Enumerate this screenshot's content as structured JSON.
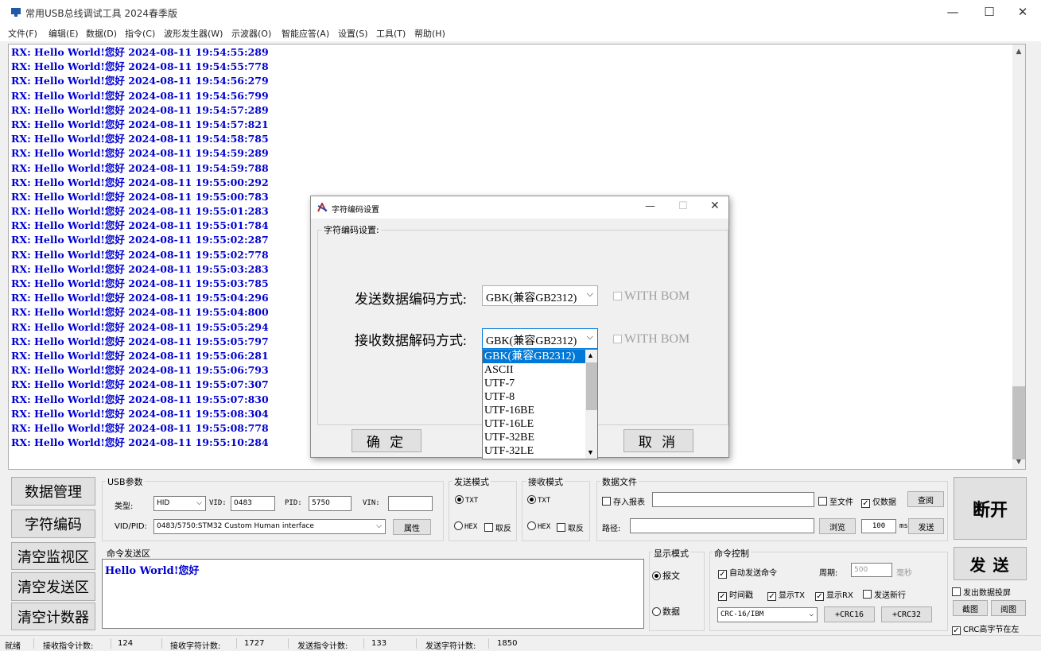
{
  "window": {
    "title": "常用USB总线调试工具 2024春季版"
  },
  "menu": [
    "文件(F)",
    "编辑(E)",
    "数据(D)",
    "指令(C)",
    "波形发生器(W)",
    "示波器(O)",
    "智能应答(A)",
    "设置(S)",
    "工具(T)",
    "帮助(H)"
  ],
  "log": {
    "lines": [
      "RX: Hello World!您好 2024-08-11 19:54:55:289",
      "RX: Hello World!您好 2024-08-11 19:54:55:778",
      "RX: Hello World!您好 2024-08-11 19:54:56:279",
      "RX: Hello World!您好 2024-08-11 19:54:56:799",
      "RX: Hello World!您好 2024-08-11 19:54:57:289",
      "RX: Hello World!您好 2024-08-11 19:54:57:821",
      "RX: Hello World!您好 2024-08-11 19:54:58:785",
      "RX: Hello World!您好 2024-08-11 19:54:59:289",
      "RX: Hello World!您好 2024-08-11 19:54:59:788",
      "RX: Hello World!您好 2024-08-11 19:55:00:292",
      "RX: Hello World!您好 2024-08-11 19:55:00:783",
      "RX: Hello World!您好 2024-08-11 19:55:01:283",
      "RX: Hello World!您好 2024-08-11 19:55:01:784",
      "RX: Hello World!您好 2024-08-11 19:55:02:287",
      "RX: Hello World!您好 2024-08-11 19:55:02:778",
      "RX: Hello World!您好 2024-08-11 19:55:03:283",
      "RX: Hello World!您好 2024-08-11 19:55:03:785",
      "RX: Hello World!您好 2024-08-11 19:55:04:296",
      "RX: Hello World!您好 2024-08-11 19:55:04:800",
      "RX: Hello World!您好 2024-08-11 19:55:05:294",
      "RX: Hello World!您好 2024-08-11 19:55:05:797",
      "RX: Hello World!您好 2024-08-11 19:55:06:281",
      "RX: Hello World!您好 2024-08-11 19:55:06:793",
      "RX: Hello World!您好 2024-08-11 19:55:07:307",
      "RX: Hello World!您好 2024-08-11 19:55:07:830",
      "RX: Hello World!您好 2024-08-11 19:55:08:304",
      "RX: Hello World!您好 2024-08-11 19:55:08:778",
      "RX: Hello World!您好 2024-08-11 19:55:10:284"
    ]
  },
  "dialog": {
    "title": "字符编码设置",
    "group_label": "字符编码设置:",
    "send_label": "发送数据编码方式:",
    "send_value": "GBK(兼容GB2312)",
    "recv_label": "接收数据解码方式:",
    "recv_value": "GBK(兼容GB2312)",
    "with_bom": "WITH BOM",
    "ok": "确  定",
    "cancel": "取  消",
    "options": [
      "GBK(兼容GB2312)",
      "ASCII",
      "UTF-7",
      "UTF-8",
      "UTF-16BE",
      "UTF-16LE",
      "UTF-32BE",
      "UTF-32LE"
    ]
  },
  "side_buttons": [
    "数据管理",
    "字符编码",
    "清空监视区",
    "清空发送区",
    "清空计数器"
  ],
  "usb": {
    "group": "USB参数",
    "type_label": "类型:",
    "type_value": "HID",
    "vid_label": "VID:",
    "vid_value": "0483",
    "pid_label": "PID:",
    "pid_value": "5750",
    "vin_label": "VIN:",
    "vin_value": "",
    "vidpid_label": "VID/PID:",
    "vidpid_value": "0483/5750:STM32 Custom Human interface",
    "prop_button": "属性"
  },
  "send_mode": {
    "group": "发送模式",
    "txt": "TXT",
    "hex": "HEX",
    "invert": "取反"
  },
  "recv_mode": {
    "group": "接收模式",
    "txt": "TXT",
    "hex": "HEX",
    "invert": "取反"
  },
  "data_file": {
    "group": "数据文件",
    "save_report": "存入报表",
    "to_file": "至文件",
    "data_only": "仅数据",
    "query": "查阅",
    "path_label": "路径:",
    "browse": "浏览",
    "interval": "100",
    "ms": "ms",
    "send": "发送"
  },
  "disconnect": "断开",
  "send_big": "发 送",
  "command": {
    "group": "命令发送区",
    "text": "Hello World!您好"
  },
  "display_mode": {
    "group": "显示模式",
    "report": "报文",
    "data": "数据"
  },
  "cmd_ctrl": {
    "group": "命令控制",
    "auto_send": "自动发送命令",
    "period_label": "周期:",
    "period_value": "500",
    "ms_label": "毫秒",
    "timestamp": "时间戳",
    "show_tx": "显示TX",
    "show_rx": "显示RX",
    "send_newline": "发送新行",
    "crc_value": "CRC-16/IBM",
    "crc16": "+CRC16",
    "crc32": "+CRC32"
  },
  "right_opts": {
    "cast": "发出数据投屏",
    "screenshot": "截图",
    "view": "阅图",
    "crc_high": "CRC高字节在左"
  },
  "status": {
    "ready": "就绪",
    "recv_cmd_label": "接收指令计数:",
    "recv_cmd": "124",
    "recv_char_label": "接收字符计数:",
    "recv_char": "1727",
    "send_cmd_label": "发送指令计数:",
    "send_cmd": "133",
    "send_char_label": "发送字符计数:",
    "send_char": "1850"
  }
}
